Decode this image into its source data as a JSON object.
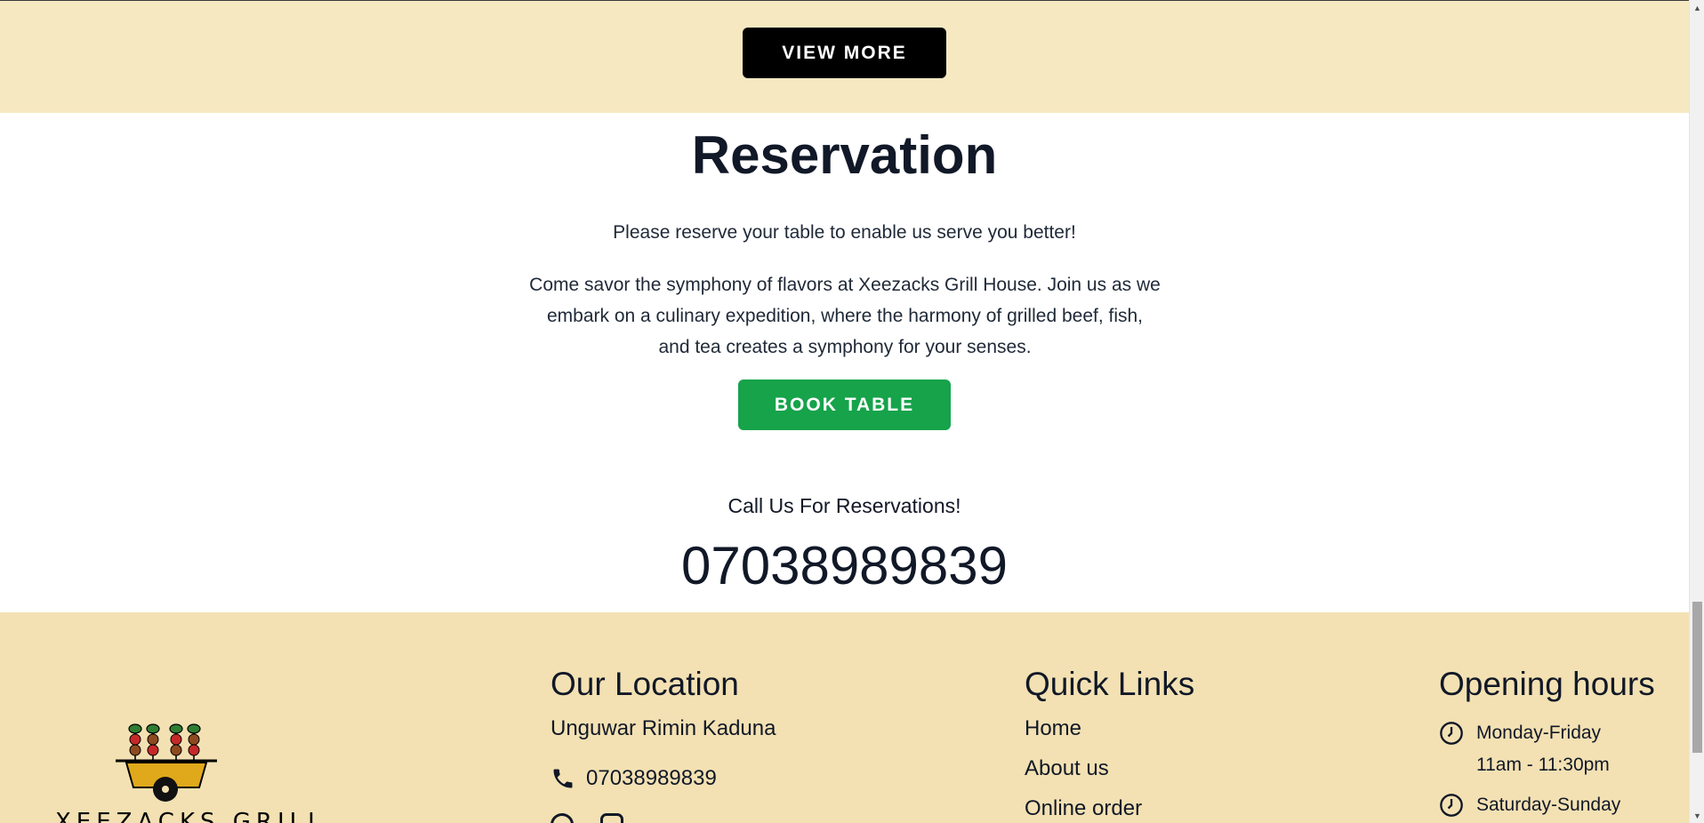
{
  "top_band": {
    "view_more_label": "VIEW MORE"
  },
  "reservation": {
    "title": "Reservation",
    "subtitle": "Please reserve your table to enable us serve you better!",
    "description": "Come savor the symphony of flavors at Xeezacks Grill House. Join us as we embark on a culinary expedition, where the harmony of grilled beef, fish, and tea creates a symphony for your senses.",
    "book_label": "BOOK TABLE",
    "call_text": "Call Us For Reservations!",
    "call_number": "07038989839"
  },
  "footer": {
    "logo_text": "XEEZACKS GRILL",
    "location": {
      "title": "Our Location",
      "address": "Unguwar Rimin Kaduna",
      "phone": "07038989839"
    },
    "quick_links": {
      "title": "Quick Links",
      "items": [
        "Home",
        "About us",
        "Online order"
      ]
    },
    "opening_hours": {
      "title": "Opening hours",
      "rows": [
        {
          "days": "Monday-Friday",
          "hours": "11am - 11:30pm"
        },
        {
          "days": "Saturday-Sunday",
          "hours": ""
        }
      ]
    }
  },
  "colors": {
    "band_bg": "#f6e8c1",
    "footer_bg": "#f3e1b3",
    "book_green": "#16a34a",
    "text_dark": "#111827"
  }
}
